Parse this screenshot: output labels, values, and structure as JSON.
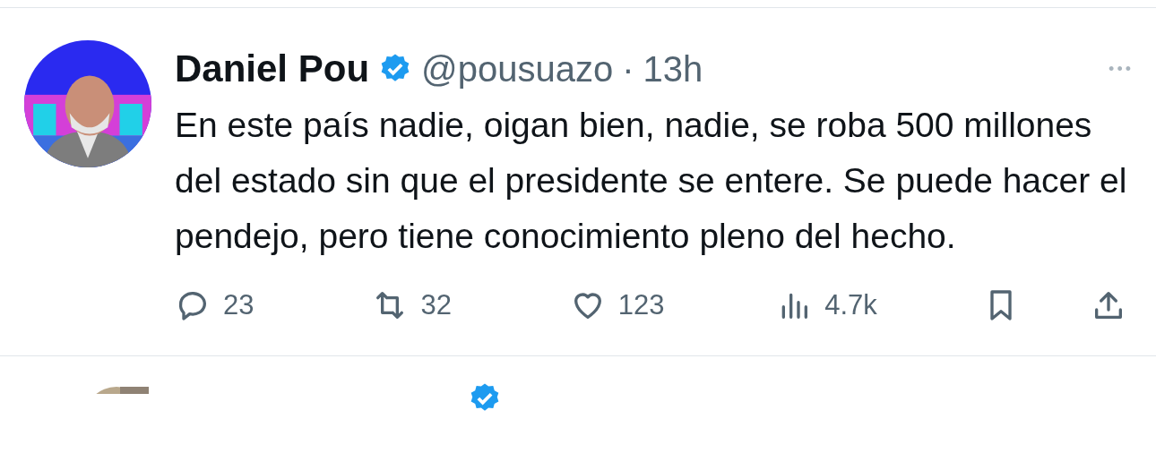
{
  "tweet": {
    "name": "Daniel Pou",
    "verified": true,
    "handle": "@pousuazo",
    "separator": "·",
    "time": "13h",
    "more": "•••",
    "text": "En este país nadie, oigan bien, nadie, se roba 500 millones del estado sin que el presidente se entere. Se puede hacer el pendejo, pero tiene conocimiento pleno del hecho.",
    "actions": [
      {
        "kind": "reply",
        "count": "23"
      },
      {
        "kind": "retweet",
        "count": "32"
      },
      {
        "kind": "like",
        "count": "123"
      },
      {
        "kind": "views",
        "count": "4.7k"
      },
      {
        "kind": "bookmark"
      },
      {
        "kind": "share"
      }
    ]
  },
  "next_tweet": {
    "verified": true
  }
}
